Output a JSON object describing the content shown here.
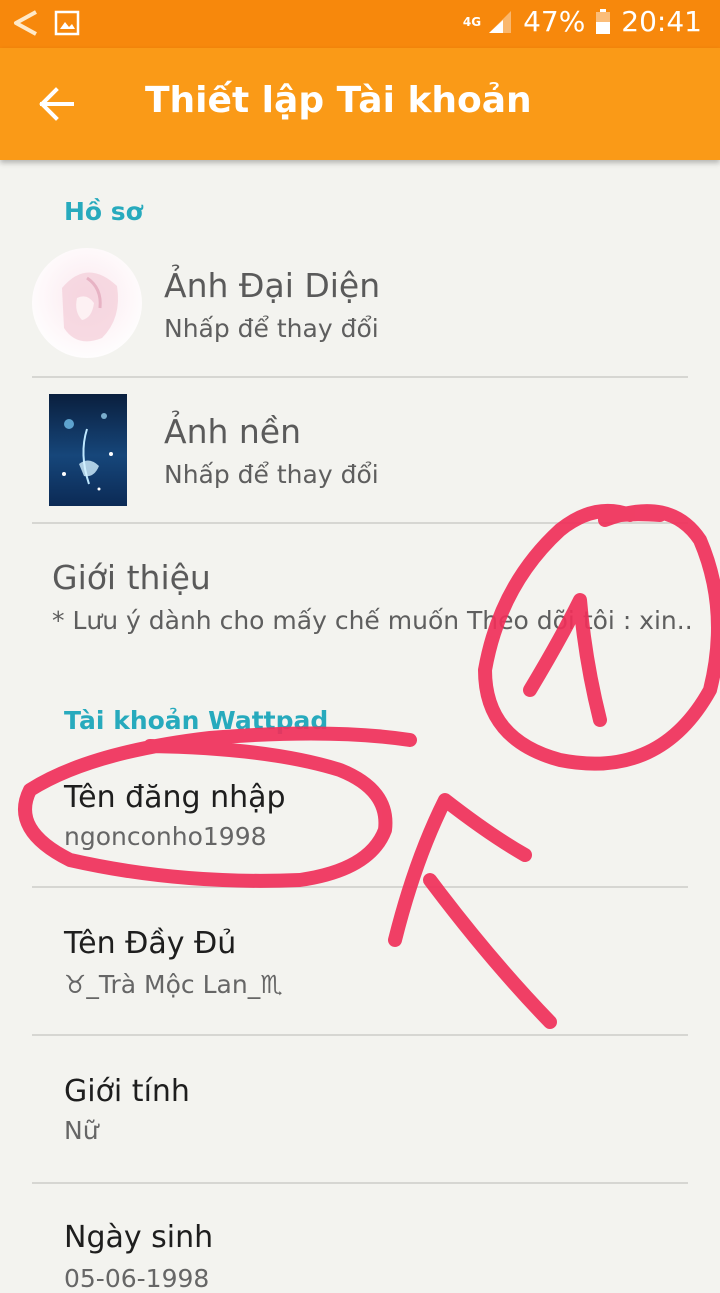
{
  "status_bar": {
    "network": "4G",
    "battery": "47%",
    "time": "20:41",
    "icons": [
      "back-arrow-icon",
      "image-icon",
      "signal-icon",
      "battery-icon"
    ]
  },
  "app_bar": {
    "title": "Thiết lập Tài khoản",
    "back_icon": "back-arrow-icon"
  },
  "profile_section": {
    "header": "Hồ sơ",
    "avatar": {
      "title": "Ảnh Đại Diện",
      "subtitle": "Nhấp để thay đổi"
    },
    "background": {
      "title": "Ảnh nền",
      "subtitle": "Nhấp để thay đổi"
    },
    "intro": {
      "title": "Giới thiệu",
      "text": "* Lưu ý dành cho mấy chế muốn Theo dõi tôi : xin.."
    }
  },
  "account_section": {
    "header": "Tài khoản Wattpad",
    "fields": [
      {
        "label": "Tên đăng nhập",
        "value": "ngonconho1998"
      },
      {
        "label": "Tên Đầy Đủ",
        "value": "♉_Trà Mộc Lan_♏"
      },
      {
        "label": "Giới tính",
        "value": "Nữ"
      },
      {
        "label": "Ngày sinh",
        "value": "05-06-1998"
      }
    ]
  },
  "colors": {
    "status_bar": "#f7880c",
    "app_bar": "#fa9a17",
    "section_header": "#27aabd",
    "annotation": "#f0305a",
    "background": "#f3f3ef"
  }
}
